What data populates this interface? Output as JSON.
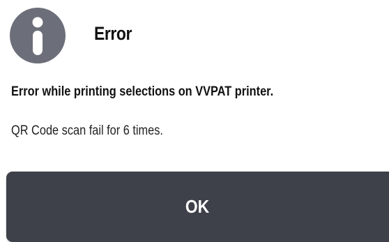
{
  "dialog": {
    "icon": "info-icon",
    "title": "Error",
    "message_heading": "Error while printing selections on VVPAT printer.",
    "message_detail": "QR Code scan fail for 6 times.",
    "ok_label": "OK"
  },
  "colors": {
    "icon_background": "#6c6f79",
    "button_background": "#3e404a",
    "button_text": "#ffffff",
    "text": "#111111"
  }
}
